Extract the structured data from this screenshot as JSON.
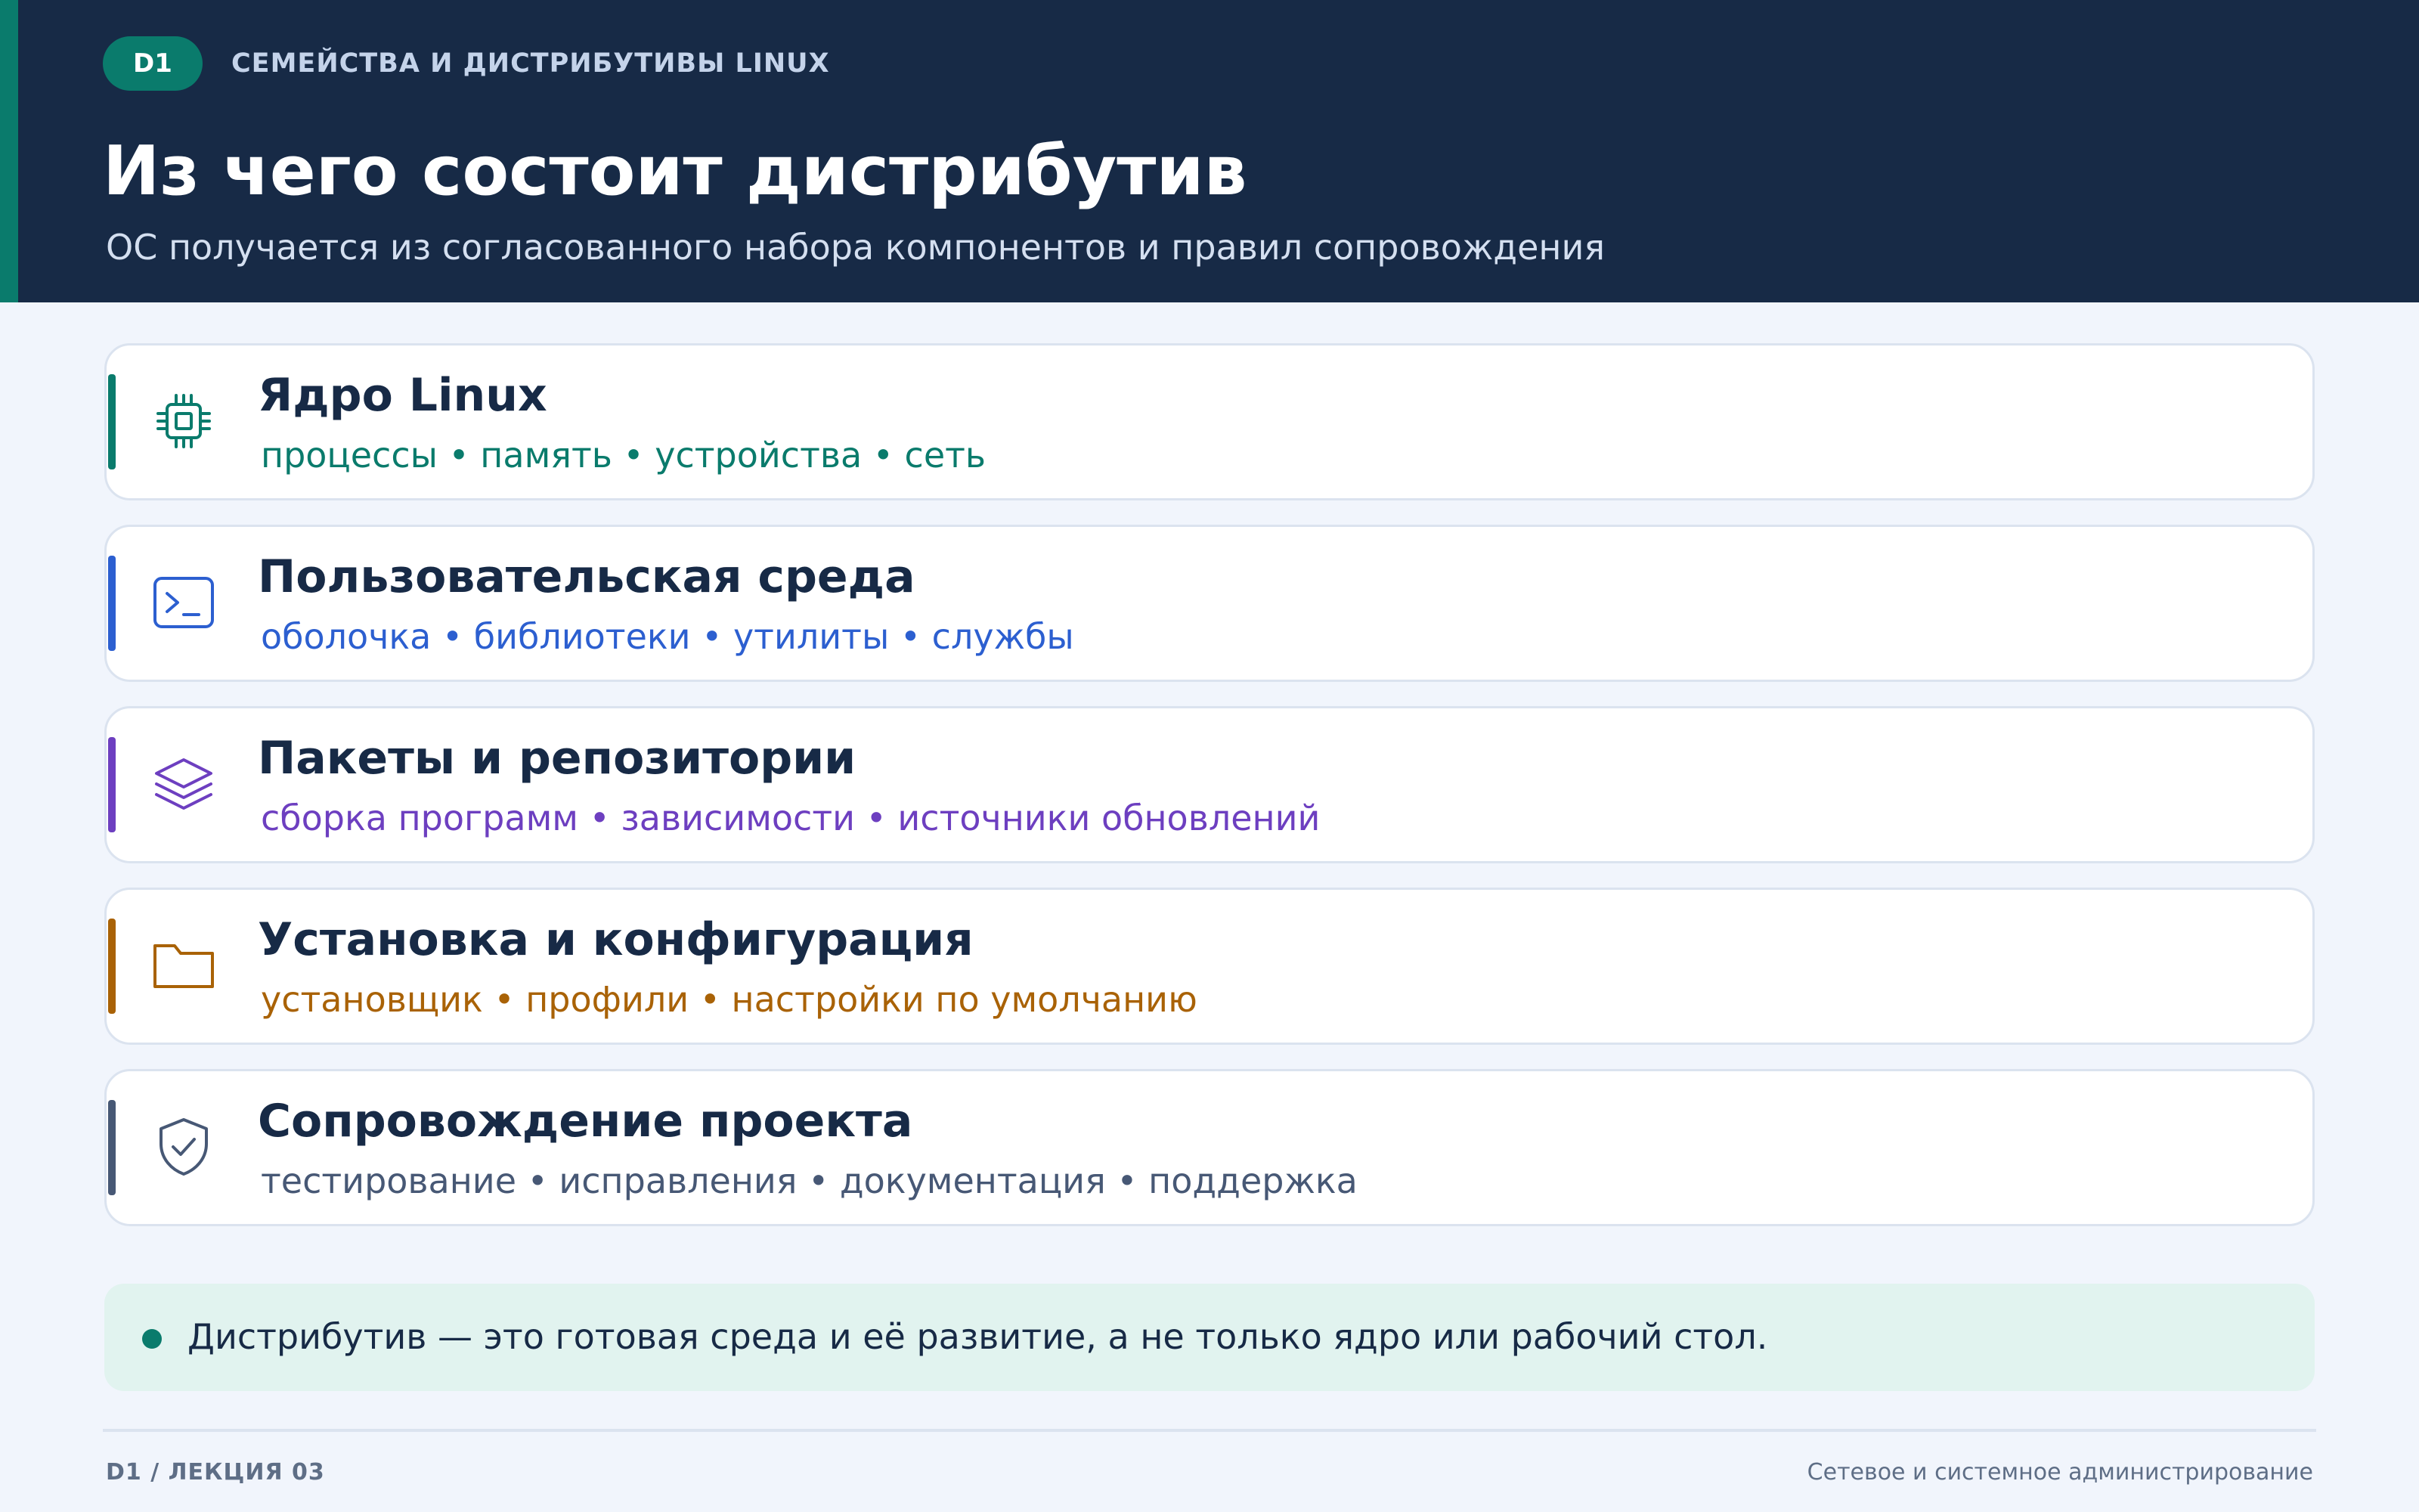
{
  "header": {
    "badge": "D1",
    "section_label": "СЕМЕЙСТВА И ДИСТРИБУТИВЫ LINUX",
    "title": "Из чего состоит дистрибутив",
    "subtitle": "ОС получается из согласованного набора компонентов и правил сопровождения",
    "colors": {
      "background": "#172a46",
      "accent": "#0a7b6c"
    }
  },
  "components": [
    {
      "icon": "cpu-chip-icon",
      "title": "Ядро Linux",
      "tags": "процессы • память • устройства • сеть",
      "color": "#0a7b6c"
    },
    {
      "icon": "terminal-icon",
      "title": "Пользовательская среда",
      "tags": "оболочка • библиотеки • утилиты • службы",
      "color": "#2c5fd0"
    },
    {
      "icon": "layers-icon",
      "title": "Пакеты и репозитории",
      "tags": "сборка программ • зависимости • источники обновлений",
      "color": "#6d3fc0"
    },
    {
      "icon": "folder-icon",
      "title": "Установка и конфигурация",
      "tags": "установщик • профили • настройки по умолчанию",
      "color": "#a96206"
    },
    {
      "icon": "shield-check-icon",
      "title": "Сопровождение проекта",
      "tags": "тестирование • исправления • документация • поддержка",
      "color": "#475875"
    }
  ],
  "note": {
    "text": "Дистрибутив — это готовая среда и её развитие, а не только ядро или рабочий стол.",
    "background": "#e1f3ef"
  },
  "footer": {
    "left": "D1 / ЛЕКЦИЯ 03",
    "right": "Сетевое и системное администрирование"
  }
}
